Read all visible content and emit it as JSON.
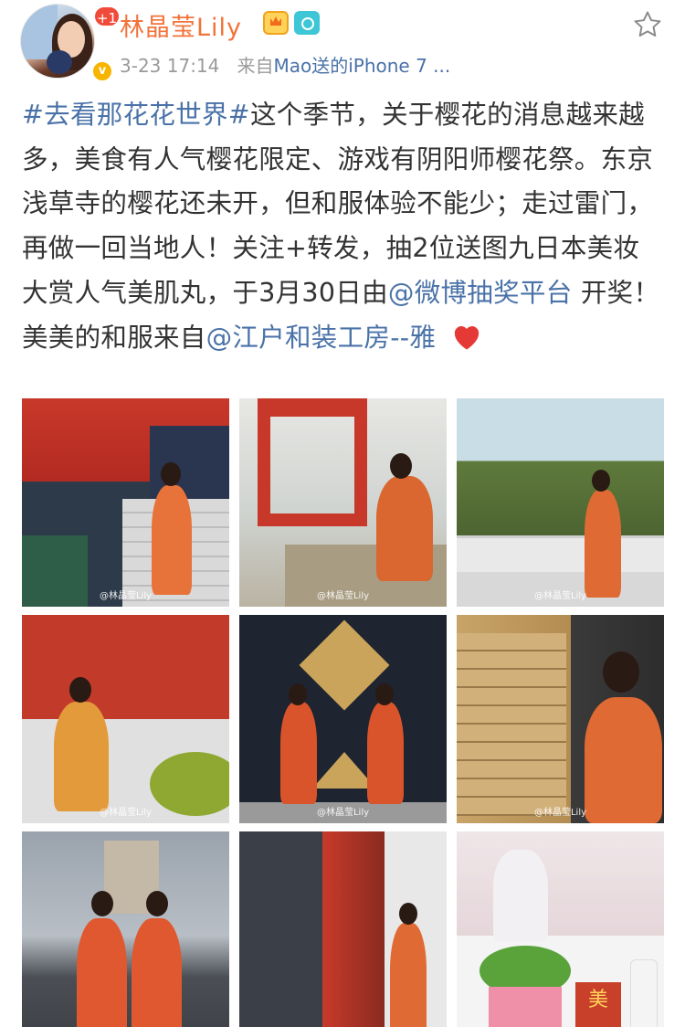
{
  "header": {
    "username": "林晶莹Lily",
    "notification_count": "+1",
    "timestamp": "3-23 17:14",
    "source_prefix": "来自",
    "source_link": "Mao送的iPhone 7 ...",
    "vip_badge": "v"
  },
  "post": {
    "topic": "#去看那花花世界#",
    "text_1": "这个季节，关于樱花的消息越来越多，美食有人气樱花限定、游戏有阴阳师樱花祭。东京浅草寺的樱花还未开，但和服体验不能少；走过雷门，再做一回当地人！关注+转发，抽2位送图九日本美妆大赏人气美肌丸，于3月30日由",
    "mention_1": "@微博抽奖平台",
    "text_2": " 开奖！美美的和服来自",
    "mention_2": "@江户和装工房--雅"
  },
  "photos": [
    {
      "watermark": "@林晶莹Lily"
    },
    {
      "watermark": "@林晶莹Lily"
    },
    {
      "watermark": "@林晶莹Lily"
    },
    {
      "watermark": "@林晶莹Lily"
    },
    {
      "watermark": "@林晶莹Lily"
    },
    {
      "watermark": "@林晶莹Lily"
    },
    {
      "watermark": ""
    },
    {
      "watermark": ""
    },
    {
      "watermark": "美"
    }
  ],
  "colors": {
    "username": "#f2733a",
    "link": "#4a72a8",
    "text": "#333333",
    "meta": "#9a9a9a",
    "heart": "#e53935"
  }
}
